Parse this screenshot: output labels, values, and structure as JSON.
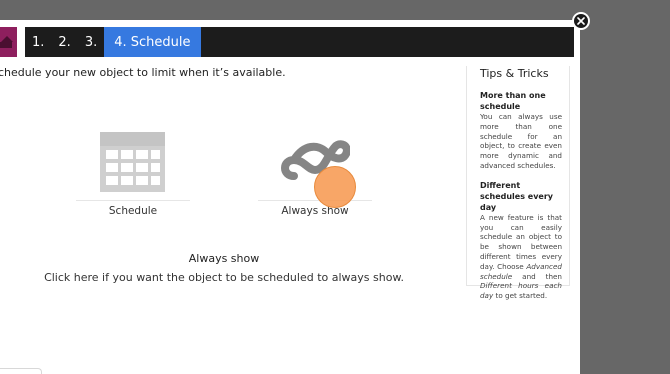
{
  "wizard": {
    "steps": [
      {
        "label": "1."
      },
      {
        "label": "2."
      },
      {
        "label": "3."
      },
      {
        "label": "4. Schedule",
        "active": true
      }
    ],
    "accent_color": "#3679e0",
    "brand_color": "#8e1f5e"
  },
  "intro": "chedule your new object to limit when it’s available.",
  "options": [
    {
      "label": "Schedule",
      "icon": "calendar-icon"
    },
    {
      "label": "Always show",
      "icon": "infinity-icon"
    }
  ],
  "selected": {
    "title": "Always show",
    "description": "Click here if you want the object to be scheduled to always show."
  },
  "tips": {
    "heading": "Tips & Tricks",
    "items": [
      {
        "title": "More than one schedule",
        "text": "You can always use more than one schedule for an object, to create even more dynamic and advanced schedules."
      },
      {
        "title": "Different schedules every day",
        "text_before": "A new feature is that you can easily schedule an object to be shown between different times every day. Choose ",
        "em1": "Advanced schedule",
        "text_mid": " and then ",
        "em2": "Different hours each day",
        "text_after": " to get started."
      }
    ]
  }
}
